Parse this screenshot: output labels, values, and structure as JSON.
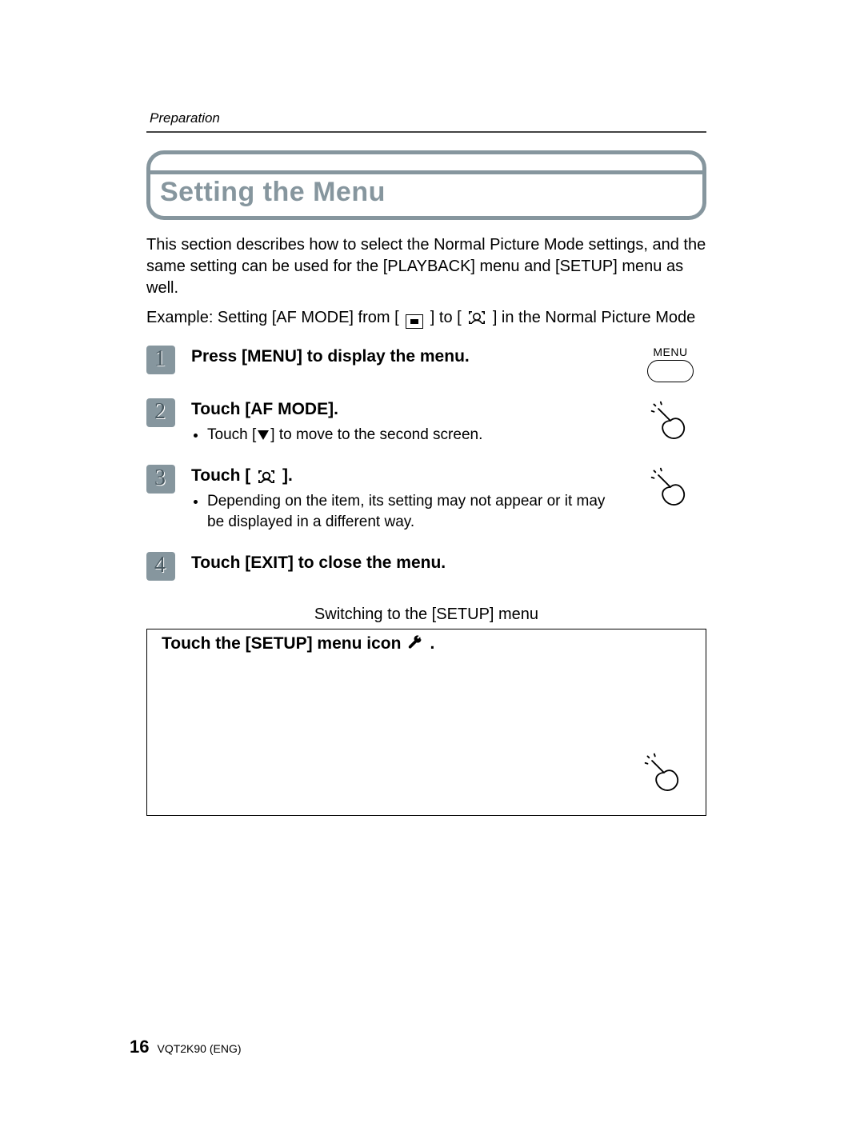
{
  "section_label": "Preparation",
  "title": "Setting the Menu",
  "intro": "This section describes how to select the Normal Picture Mode settings, and the same setting can be used for the [PLAYBACK] menu and [SETUP] menu as well.",
  "example_prefix": "Example: Setting [AF MODE] from [",
  "example_mid": "] to [",
  "example_suffix": "] in the Normal Picture Mode",
  "menu_button_label": "MENU",
  "steps": {
    "s1": {
      "num": "1",
      "title": "Press [MENU] to display the menu."
    },
    "s2": {
      "num": "2",
      "title": "Touch [AF MODE].",
      "bullet_prefix": "Touch [",
      "bullet_suffix": "] to move to the second screen."
    },
    "s3": {
      "num": "3",
      "title_prefix": "Touch [",
      "title_suffix": "].",
      "bullet": "Depending on the item, its setting may not appear or it may be displayed in a different way."
    },
    "s4": {
      "num": "4",
      "title": "Touch [EXIT] to close the menu."
    }
  },
  "callout": {
    "tab": "Switching to the [SETUP] menu",
    "body": "Touch the [SETUP] menu icon",
    "period": "."
  },
  "footer": {
    "page": "16",
    "doc": "VQT2K90 (ENG)"
  }
}
